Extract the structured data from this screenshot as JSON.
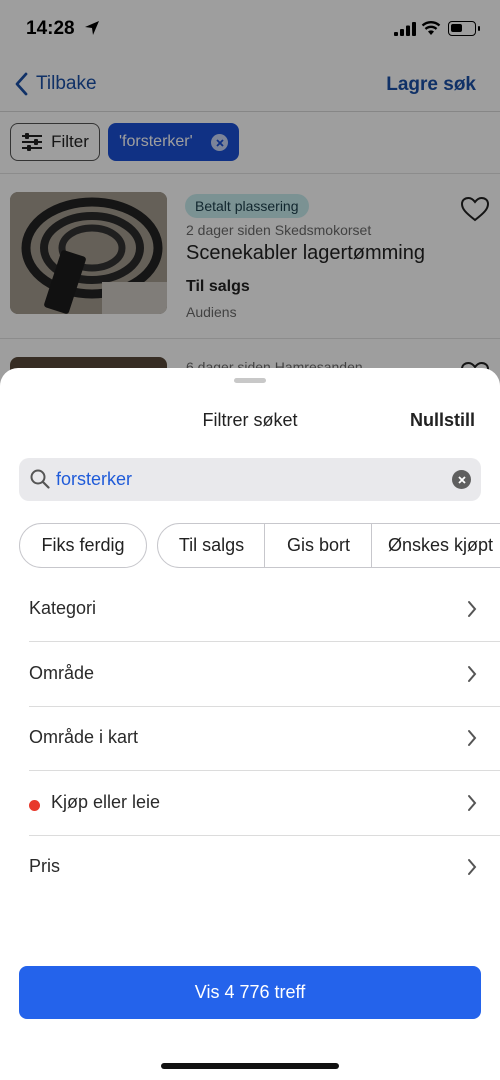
{
  "status_bar": {
    "time": "14:28"
  },
  "nav": {
    "back_label": "Tilbake",
    "save_search_label": "Lagre søk"
  },
  "filter_row": {
    "filter_label": "Filter",
    "query_chip": "'forsterker'"
  },
  "listings": [
    {
      "badge": "Betalt plassering",
      "meta": "2 dager siden   Skedsmokorset",
      "title": "Scenekabler lagertømming",
      "status": "Til salgs",
      "seller": "Audiens"
    },
    {
      "meta": "6 dager siden   Hamresanden"
    }
  ],
  "sheet": {
    "title": "Filtrer søket",
    "reset_label": "Nullstill",
    "search_value": "forsterker",
    "chips": [
      "Fiks ferdig",
      "Til salgs",
      "Gis bort",
      "Ønskes kjøpt"
    ],
    "rows": [
      {
        "label": "Kategori"
      },
      {
        "label": "Område"
      },
      {
        "label": "Område i kart"
      },
      {
        "label": "Kjøp eller leie"
      },
      {
        "label": "Pris"
      }
    ],
    "cta_label": "Vis 4 776 treff"
  }
}
